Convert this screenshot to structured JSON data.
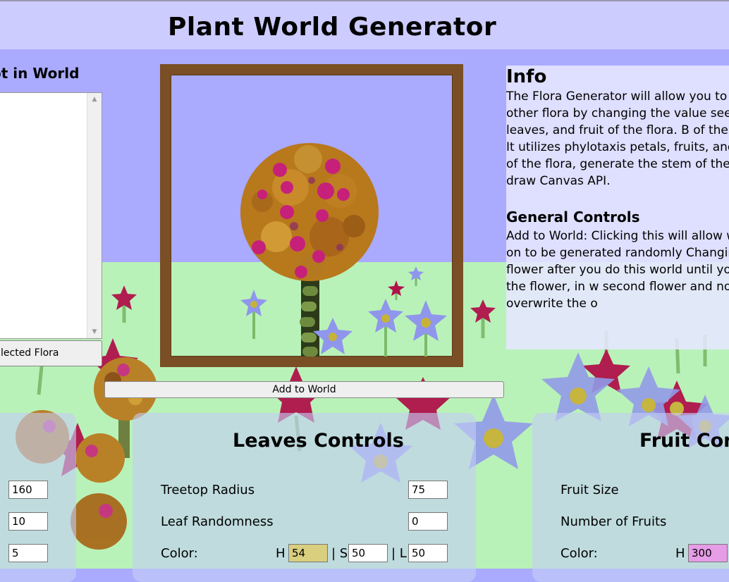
{
  "header": {
    "title": "Plant World Generator"
  },
  "left": {
    "list_title": "ot in World",
    "select_button": "lected Flora"
  },
  "add_button": "Add to World",
  "info": {
    "heading": "Info",
    "paragraph": "The Flora Generator will allow you to and other flora by changing the value seeds, leaves, and fruit of the flora. B of the controls. It utilizes phylotaxis petals, fruits, and leaves of the flora, generate the stem of the flora. It draw Canvas API.",
    "general_heading": "General Controls",
    "general_paragraph": "Add to World: Clicking this will allow working on to be generated randomly Changing the flower after you do this world until you re-add the flower, in w second flower and not overwrite the o"
  },
  "stem_controls": {
    "values": [
      "160",
      "10",
      "5"
    ]
  },
  "leaves_controls": {
    "title": "Leaves Controls",
    "treetop_radius_label": "Treetop Radius",
    "treetop_radius_value": "75",
    "leaf_randomness_label": "Leaf Randomness",
    "leaf_randomness_value": "0",
    "color_label": "Color:",
    "h_label": "H",
    "h_value": "54",
    "s_label": "| S",
    "s_value": "50",
    "l_label": "| L",
    "l_value": "50"
  },
  "fruit_controls": {
    "title": "Fruit Cont",
    "fruit_size_label": "Fruit Size",
    "number_of_fruits_label": "Number of Fruits",
    "color_label": "Color:",
    "h_label": "H",
    "h_value": "300"
  },
  "colors": {
    "sky": "#aaaaff",
    "grass": "#b9f2b9",
    "header": "#ccccff",
    "frame": "#7a4f26",
    "leaf_hue_field": "#d9cf7f",
    "fruit_hue_field": "#e69ce6"
  }
}
